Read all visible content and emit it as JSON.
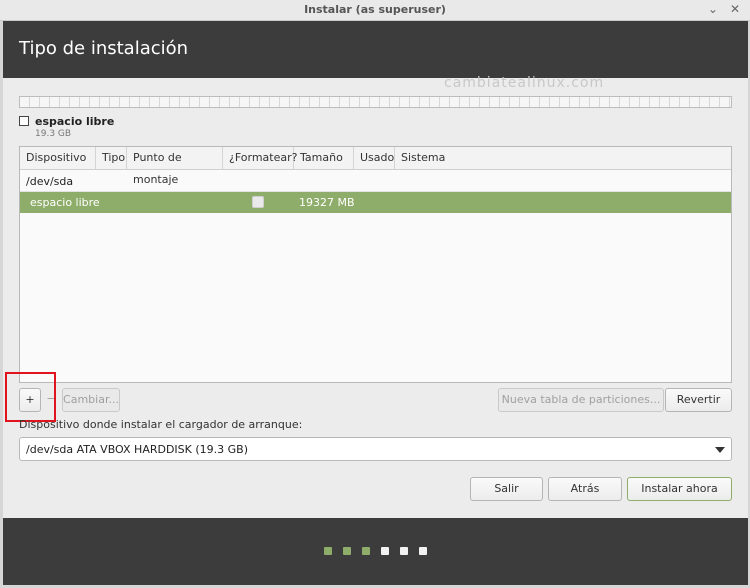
{
  "window": {
    "title": "Instalar (as superuser)",
    "minimize": "⌄",
    "close": "✕"
  },
  "header": {
    "title": "Tipo de instalación"
  },
  "watermark": "cambiatealinux.com",
  "legend": {
    "label": "espacio libre",
    "size": "19.3 GB"
  },
  "table": {
    "columns": [
      "Dispositivo",
      "Tipo",
      "Punto de montaje",
      "¿Formatear?",
      "Tamaño",
      "Usado",
      "Sistema"
    ],
    "device_row": "/dev/sda",
    "selected_row": {
      "name": "espacio libre",
      "format": false,
      "size": "19327 MB"
    }
  },
  "actions": {
    "add": "+",
    "remove": "−",
    "change": "Cambiar...",
    "new_table": "Nueva tabla de particiones...",
    "revert": "Revertir"
  },
  "bootloader": {
    "label": "Dispositivo donde instalar el cargador de arranque:",
    "value": "/dev/sda ATA VBOX HARDDISK (19.3 GB)"
  },
  "nav": {
    "quit": "Salir",
    "back": "Atrás",
    "install": "Instalar ahora"
  },
  "progress": {
    "steps_total": 6,
    "steps_done": 3
  },
  "colors": {
    "accent": "#8fad6a",
    "header_bg": "#3c3c3c",
    "highlight": "#e0141e"
  }
}
